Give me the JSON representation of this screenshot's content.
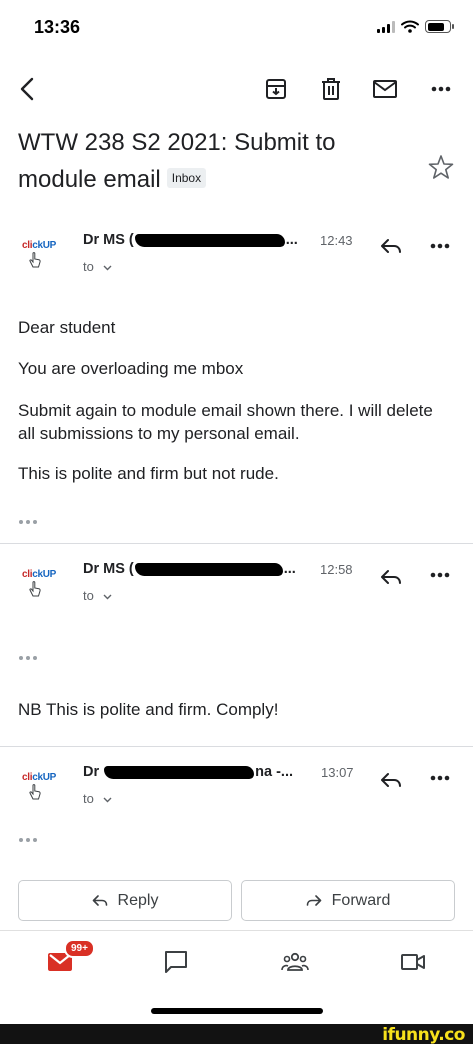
{
  "status_bar": {
    "time": "13:36"
  },
  "toolbar": {
    "icons": [
      "back-icon",
      "archive-icon",
      "delete-icon",
      "mark-unread-icon",
      "more-icon"
    ]
  },
  "subject": {
    "title": "WTW 238 S2 2021: Submit to module email",
    "label": "Inbox"
  },
  "messages": [
    {
      "logo": {
        "part1": "cl",
        "part2": "ckUP"
      },
      "sender_prefix": "Dr MS (",
      "sender_suffix": "...",
      "time": "12:43",
      "to": "to",
      "body": [
        "Dear student",
        "You are overloading me mbox",
        "Submit again to module email shown there. I will delete all submissions to my personal email.",
        "This is polite and firm but not rude."
      ]
    },
    {
      "logo": {
        "part1": "cl",
        "part2": "ckUP"
      },
      "sender_prefix": "Dr MS (",
      "sender_suffix": "...",
      "time": "12:58",
      "to": "to",
      "body": [
        "NB This is polite and firm. Comply!"
      ]
    },
    {
      "logo": {
        "part1": "cl",
        "part2": "ckUP"
      },
      "sender_prefix": "Dr",
      "sender_suffix": "na -...",
      "time": "13:07",
      "to": "to",
      "body": []
    }
  ],
  "actions": {
    "reply": "Reply",
    "forward": "Forward"
  },
  "bottom_nav": {
    "mail_badge": "99+",
    "items": [
      "mail-icon",
      "chat-icon",
      "spaces-icon",
      "meet-icon"
    ]
  },
  "watermark": {
    "text": "ifunny.co"
  },
  "colors": {
    "accent_red": "#d93025",
    "badge_bg": "#eceff1",
    "text": "#202124",
    "muted": "#5f6368"
  }
}
